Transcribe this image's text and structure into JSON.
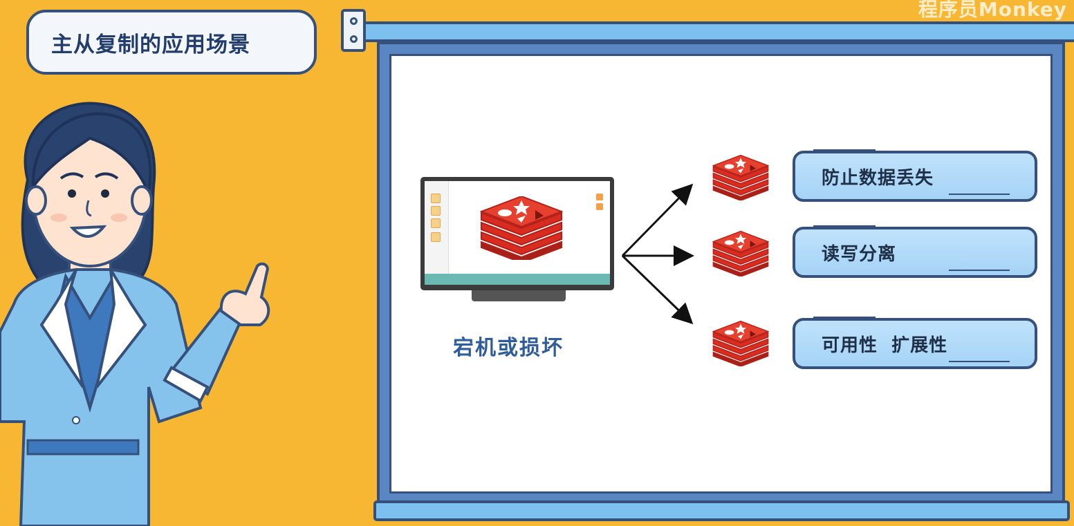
{
  "title": "主从复制的应用场景",
  "watermark": "程序员Monkey",
  "monitor_caption": "宕机或损坏",
  "outcomes": [
    {
      "label": "防止数据丢失"
    },
    {
      "label": "读写分离"
    },
    {
      "label": "可用性  扩展性"
    }
  ],
  "icons": {
    "database": "redis-logo-icon",
    "arrow": "arrow-icon",
    "monitor": "monitor-icon",
    "presenter": "presenter-illustration"
  },
  "colors": {
    "background": "#f7b733",
    "redis_red": "#d82c20",
    "frame_blue": "#5a86c4",
    "outline": "#35507a",
    "caption_blue": "#2f5d9c",
    "pill_blue": "#a5d3f6"
  }
}
